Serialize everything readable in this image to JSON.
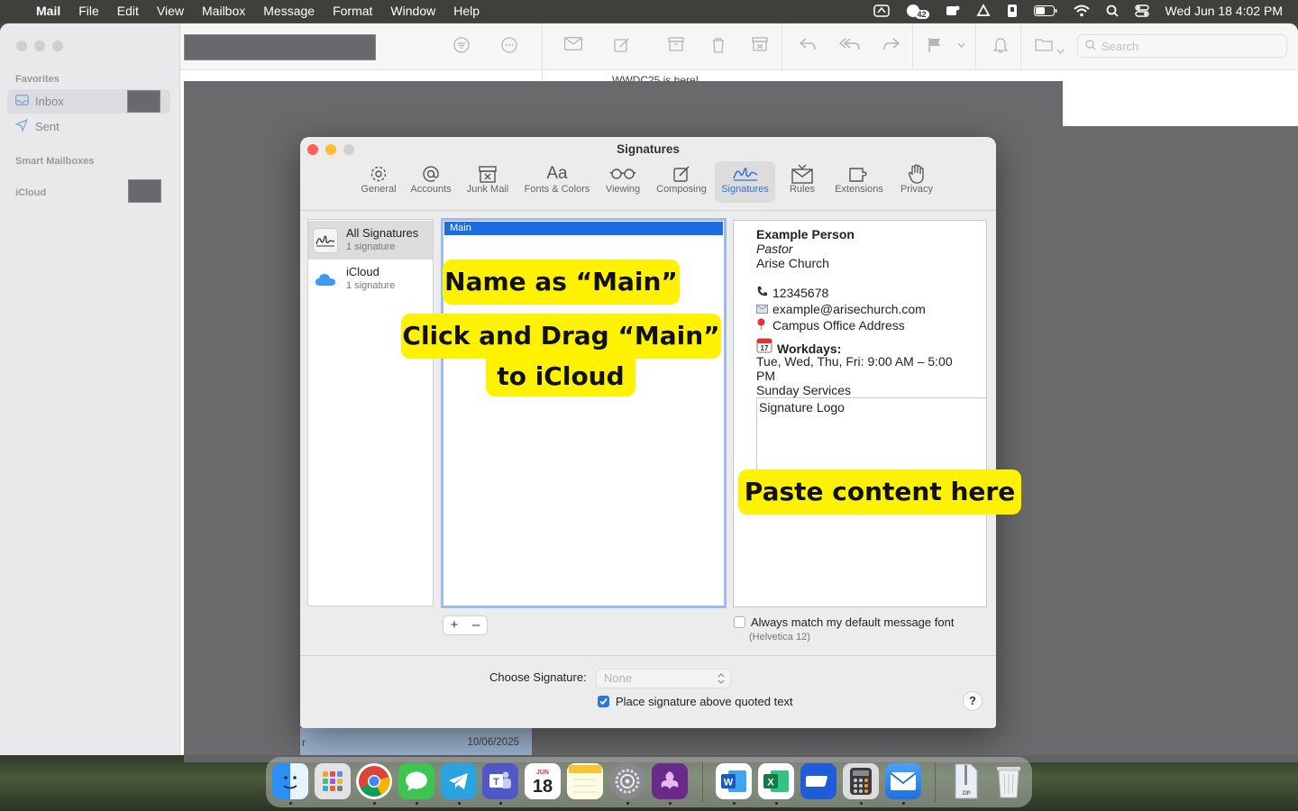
{
  "menubar": {
    "app": "Mail",
    "items": [
      "File",
      "Edit",
      "View",
      "Mailbox",
      "Message",
      "Format",
      "Window",
      "Help"
    ],
    "notif_badge": "42",
    "datetime": "Wed Jun 18  4:02 PM"
  },
  "sidebar": {
    "favorites_header": "Favorites",
    "inbox": "Inbox",
    "sent": "Sent",
    "smart_header": "Smart Mailboxes",
    "icloud": "iCloud"
  },
  "toolbar": {
    "search_placeholder": "Search"
  },
  "background": {
    "peek_text": "WWDC25 is here!",
    "list_row_left": "r",
    "list_row_date": "10/06/2025"
  },
  "dialog": {
    "title": "Signatures",
    "tabs": [
      "General",
      "Accounts",
      "Junk Mail",
      "Fonts & Colors",
      "Viewing",
      "Composing",
      "Signatures",
      "Rules",
      "Extensions",
      "Privacy"
    ],
    "selected_tab": "Signatures",
    "accounts": [
      {
        "name": "All Signatures",
        "count": "1 signature"
      },
      {
        "name": "iCloud",
        "count": "1 signature"
      }
    ],
    "signatures": [
      "Main"
    ],
    "preview": {
      "name": "Example Person",
      "title": "Pastor",
      "org": "Arise Church",
      "phone": "12345678",
      "email": "example@arisechurch.com",
      "address": "Campus Office Address",
      "workdays_label": "Workdays:",
      "hours_line1": "Tue, Wed, Thu, Fri: 9:00 AM – 5:00",
      "hours_line2": "PM",
      "services": "Sunday Services",
      "logo": "Signature Logo"
    },
    "add_button": "+",
    "remove_button": "–",
    "match_font_label": "Always match my default message font",
    "match_font_note": "(Helvetica 12)",
    "choose_label": "Choose Signature:",
    "choose_value": "None",
    "place_above_label": "Place signature above quoted text",
    "help": "?"
  },
  "callouts": {
    "name": "Name as “Main”",
    "drag_line1": "Click and Drag “Main”",
    "drag_line2": "to iCloud",
    "paste": "Paste content here"
  },
  "colors": {
    "accent": "#2a76d2",
    "callout": "#fff200"
  }
}
